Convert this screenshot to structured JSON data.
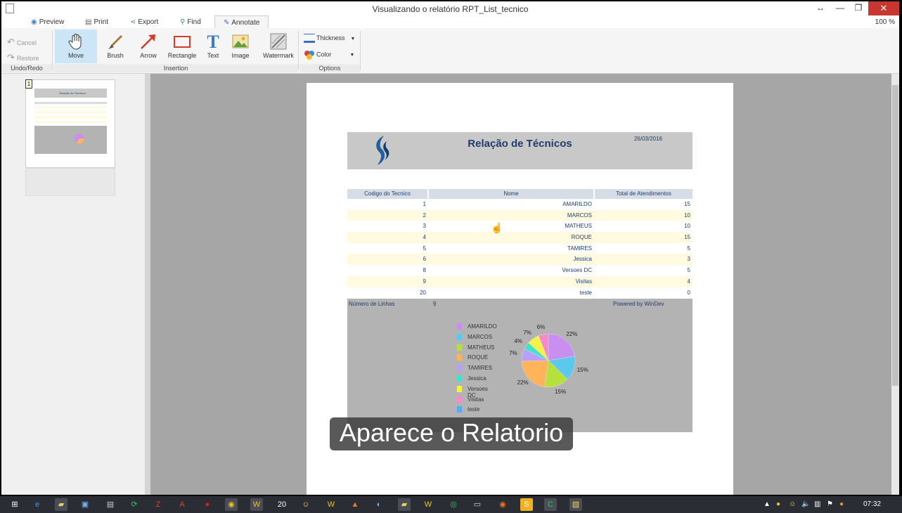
{
  "window": {
    "title": "Visualizando o relatório RPT_List_tecnico",
    "zoom": "100 %"
  },
  "tabs": [
    {
      "label": "Preview",
      "icon": "eye-icon"
    },
    {
      "label": "Print",
      "icon": "printer-icon"
    },
    {
      "label": "Export",
      "icon": "share-icon"
    },
    {
      "label": "Find",
      "icon": "magnifier-icon"
    },
    {
      "label": "Annotate",
      "icon": "pencil-icon",
      "active": true
    }
  ],
  "ribbon": {
    "undo": {
      "cancel": "Cancel",
      "restore": "Restore",
      "group": "Undo/Redo"
    },
    "insertion": {
      "buttons": [
        {
          "label": "Move",
          "icon": "hand-icon",
          "active": true
        },
        {
          "label": "Brush",
          "icon": "brush-icon"
        },
        {
          "label": "Arrow",
          "icon": "arrow-icon"
        },
        {
          "label": "Rectangle",
          "icon": "rectangle-icon"
        },
        {
          "label": "Text",
          "icon": "text-icon"
        },
        {
          "label": "Image",
          "icon": "image-icon"
        },
        {
          "label": "Watermark",
          "icon": "watermark-icon"
        }
      ],
      "group": "Insertion"
    },
    "options": {
      "thickness": "Thickness",
      "color": "Color",
      "group": "Options"
    }
  },
  "thumbnails": {
    "page_number": "1"
  },
  "report": {
    "title": "Relação de Técnicos",
    "date": "26/03/2016",
    "columns": [
      "Codigo do Tecnico",
      "Nome",
      "Total de Atendimentos"
    ],
    "rows": [
      [
        "1",
        "AMARILDO",
        "15"
      ],
      [
        "2",
        "MARCOS",
        "10"
      ],
      [
        "3",
        "MATHEUS",
        "10"
      ],
      [
        "4",
        "ROQUE",
        "15"
      ],
      [
        "5",
        "TAMIRES",
        "5"
      ],
      [
        "6",
        "Jessica",
        "3"
      ],
      [
        "8",
        "Versoes DC",
        "5"
      ],
      [
        "9",
        "Visitas",
        "4"
      ],
      [
        "20",
        "teste",
        "0"
      ]
    ],
    "footer": {
      "lines_label": "Número de Linhas",
      "lines_value": "9",
      "powered": "Powered by WinDev"
    }
  },
  "chart_data": {
    "type": "pie",
    "categories": [
      "AMARILDO",
      "MARCOS",
      "MATHEUS",
      "ROQUE",
      "TAMIRES",
      "Jessica",
      "Versoes DC",
      "Visitas",
      "teste"
    ],
    "values": [
      15,
      10,
      10,
      15,
      5,
      3,
      5,
      4,
      0
    ],
    "slice_labels": [
      "22%",
      "15%",
      "15%",
      "22%",
      "7%",
      "4%",
      "7%",
      "6%"
    ],
    "colors": [
      "#c98ff0",
      "#5bc8ec",
      "#b6e03c",
      "#ffb45a",
      "#b8a0f8",
      "#46e0cc",
      "#f2f24a",
      "#f58acb",
      "#5aaaf0"
    ]
  },
  "caption": "Aparece o Relatorio",
  "taskbar": {
    "time": "07:32"
  }
}
